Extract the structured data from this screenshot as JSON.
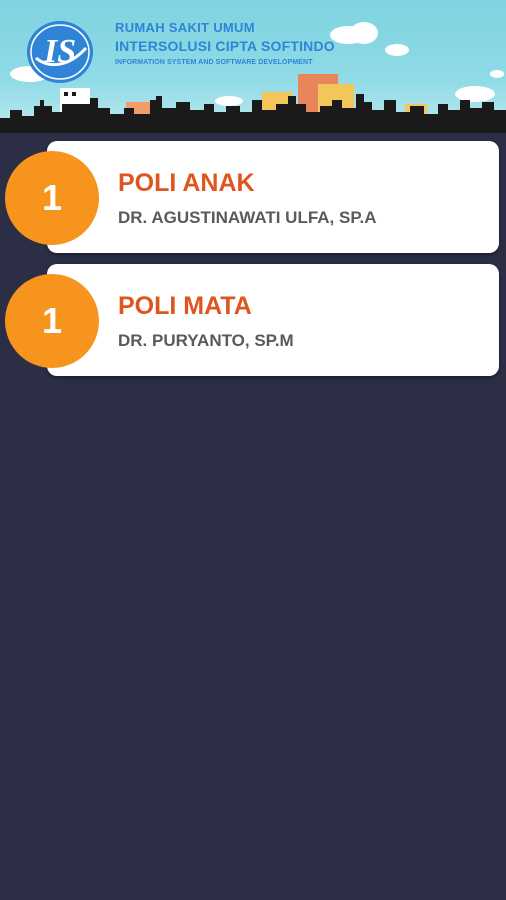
{
  "header": {
    "line1": "RUMAH SAKIT UMUM",
    "line2": "INTERSOLUSI CIPTA SOFTINDO",
    "line3": "INFORMATION SYSTEM AND SOFTWARE DEVELOPMENT",
    "logo_icon": "hospital-logo-icon",
    "logo_text": "IS"
  },
  "queues": [
    {
      "number": "1",
      "poli": "POLI ANAK",
      "doctor": "DR. AGUSTINAWATI ULFA, SP.A"
    },
    {
      "number": "1",
      "poli": "POLI MATA",
      "doctor": "DR. PURYANTO, SP.M"
    }
  ],
  "colors": {
    "background": "#2b2e45",
    "badge": "#f7941e",
    "poli_text": "#e0541f",
    "doctor_text": "#5a5a5a",
    "header_text": "#2f84d8"
  }
}
